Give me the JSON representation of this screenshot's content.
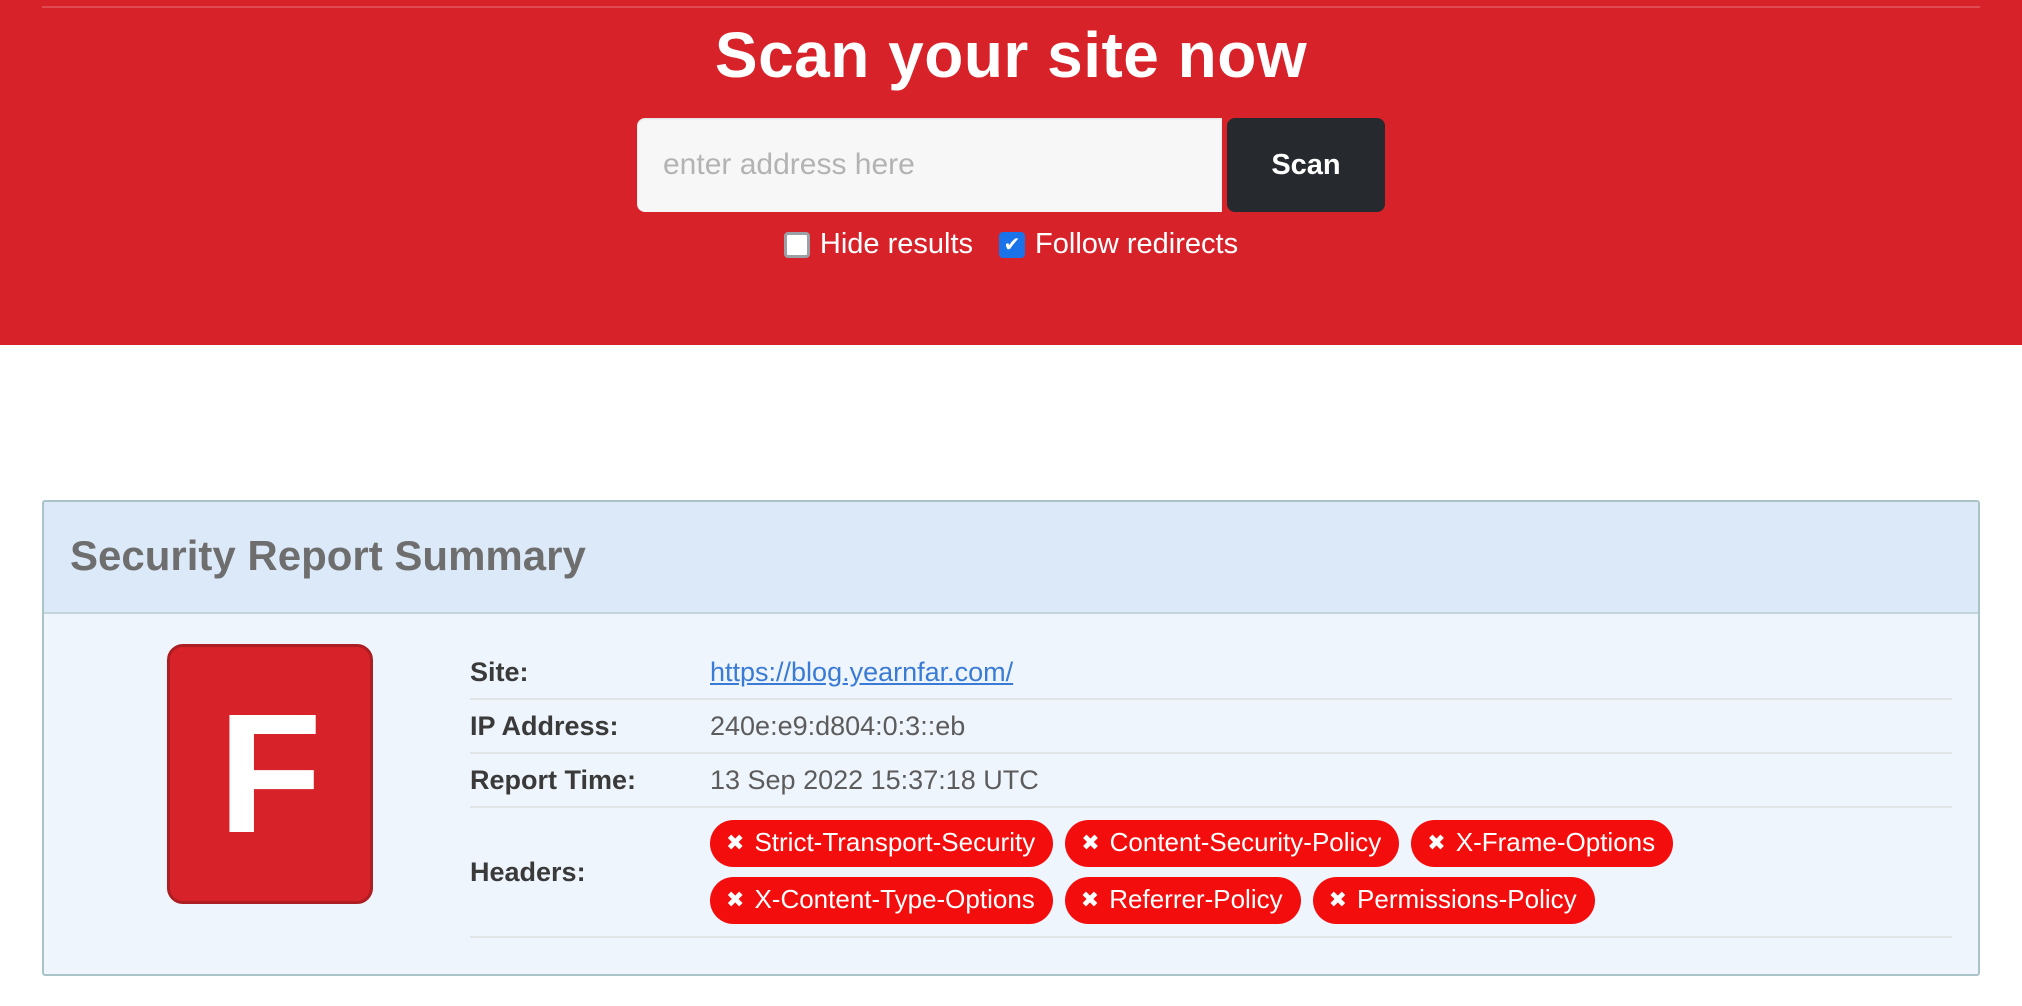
{
  "hero": {
    "title": "Scan your site now",
    "search": {
      "placeholder": "enter address here",
      "value": ""
    },
    "scan_button_label": "Scan",
    "options": [
      {
        "label": "Hide results",
        "checked": false,
        "check_glyph": ""
      },
      {
        "label": "Follow redirects",
        "checked": true,
        "check_glyph": "✔"
      }
    ],
    "colors": {
      "background": "#d8222a",
      "button": "#262a2e",
      "checkbox_checked": "#1a73e8"
    }
  },
  "report": {
    "panel_title": "Security Report Summary",
    "grade": "F",
    "grade_color": "#d8222a",
    "rows": [
      {
        "label": "Site:",
        "value": "https://blog.yearnfar.com/",
        "type": "link"
      },
      {
        "label": "IP Address:",
        "value": "240e:e9:d804:0:3::eb",
        "type": "text"
      },
      {
        "label": "Report Time:",
        "value": "13 Sep 2022 15:37:18 UTC",
        "type": "text"
      }
    ],
    "headers_label": "Headers:",
    "missing_headers": [
      {
        "name": "Strict-Transport-Security",
        "icon": "cross-icon",
        "glyph": "✖"
      },
      {
        "name": "Content-Security-Policy",
        "icon": "cross-icon",
        "glyph": "✖"
      },
      {
        "name": "X-Frame-Options",
        "icon": "cross-icon",
        "glyph": "✖"
      },
      {
        "name": "X-Content-Type-Options",
        "icon": "cross-icon",
        "glyph": "✖"
      },
      {
        "name": "Referrer-Policy",
        "icon": "cross-icon",
        "glyph": "✖"
      },
      {
        "name": "Permissions-Policy",
        "icon": "cross-icon",
        "glyph": "✖"
      }
    ],
    "badge_color": "#f40d0d",
    "panel_header_color": "#dce9f9",
    "panel_body_color": "#eff5fd"
  }
}
